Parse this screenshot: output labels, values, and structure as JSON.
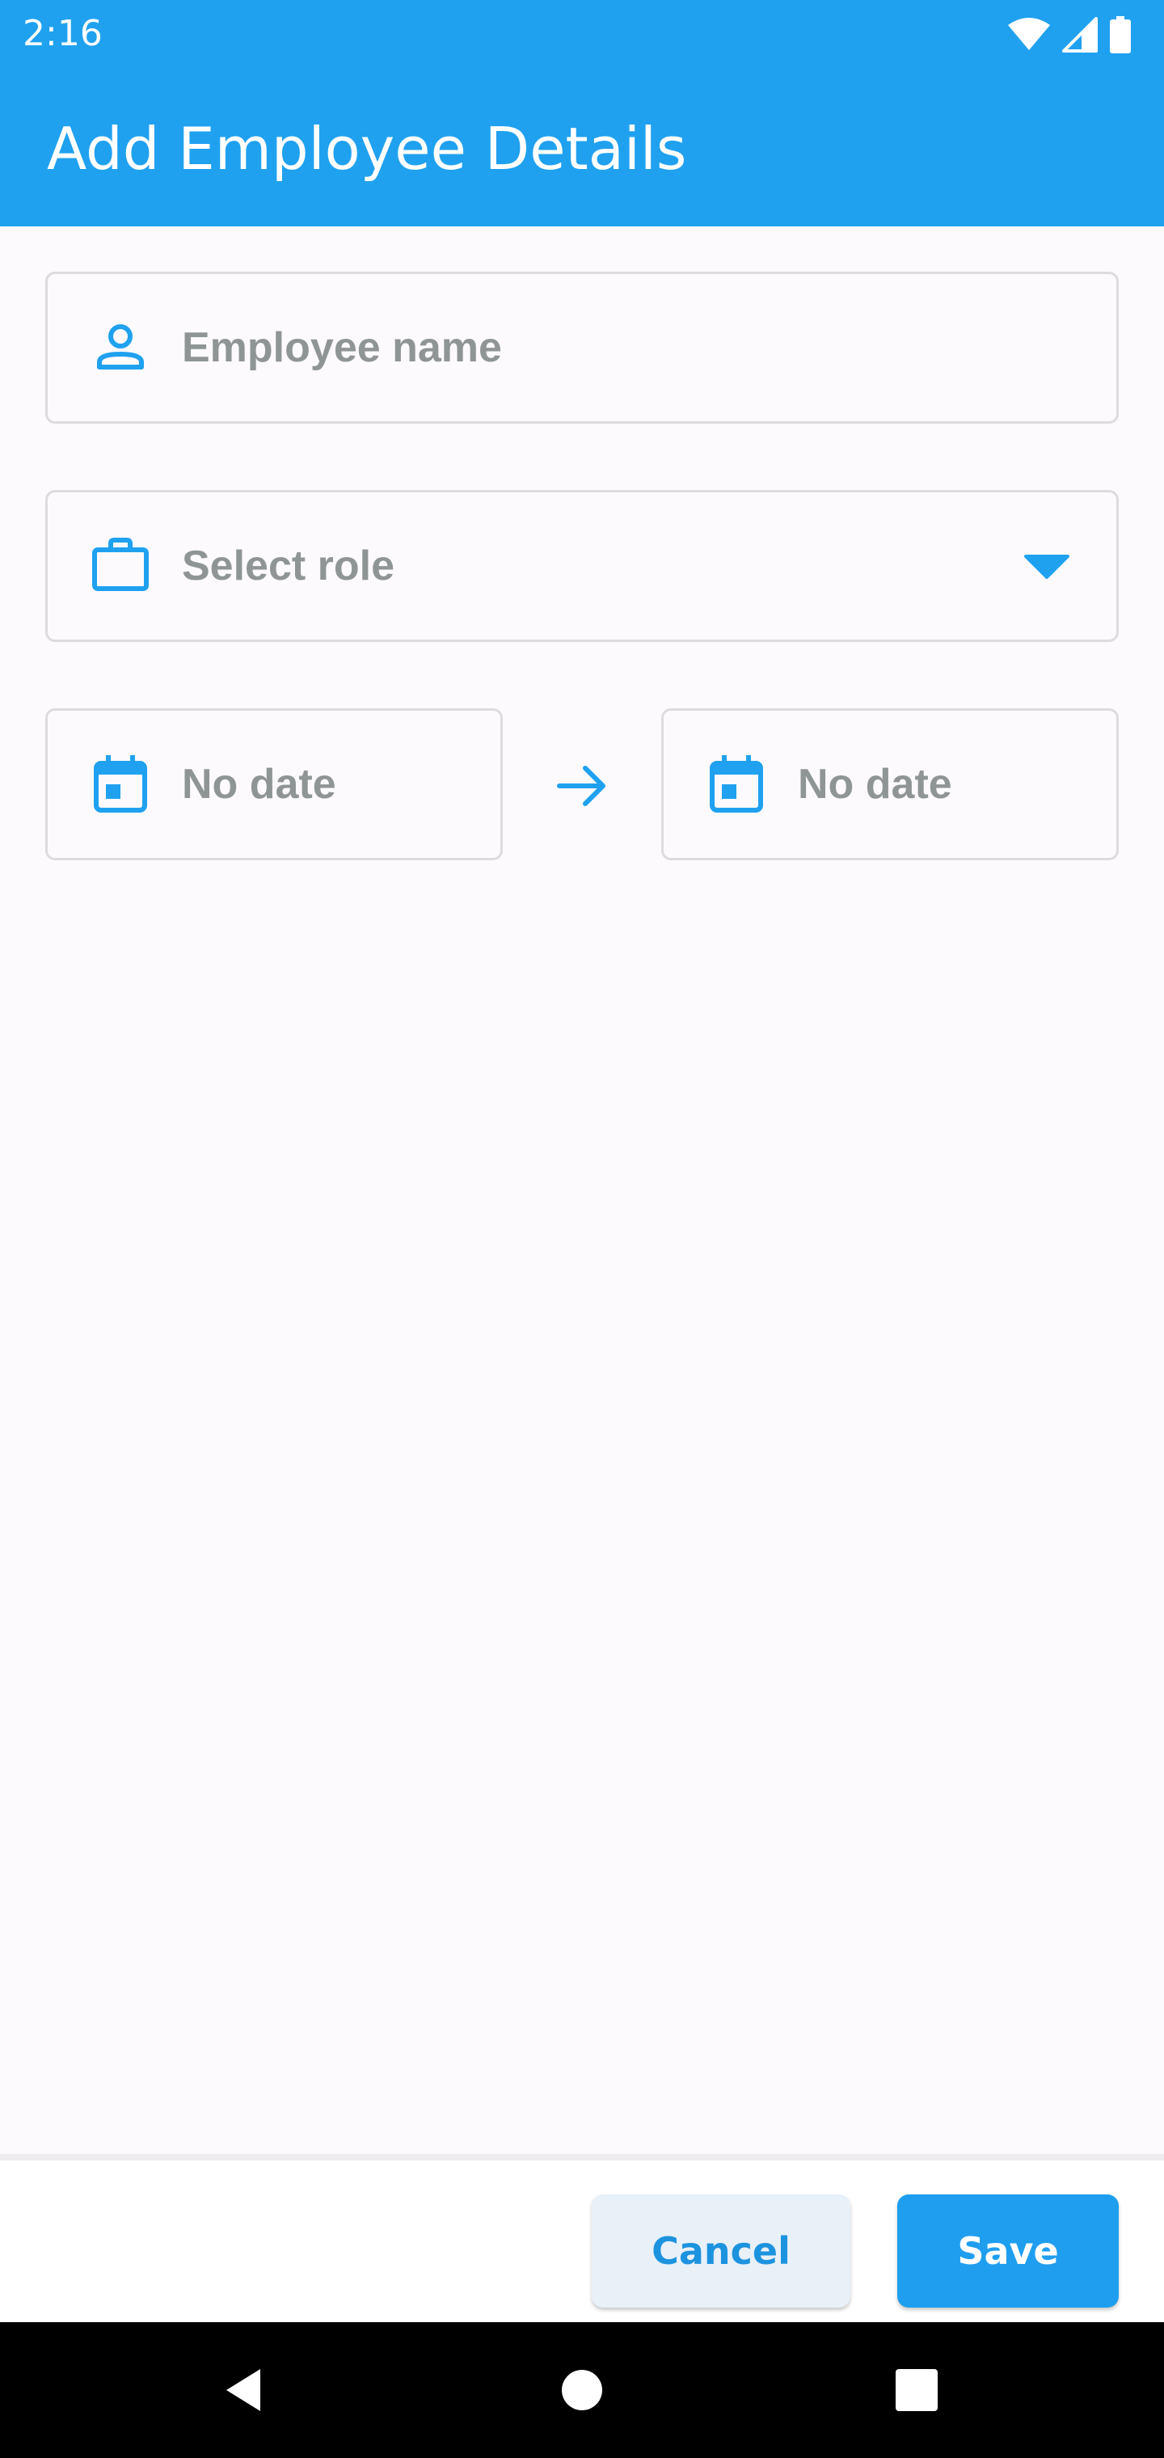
{
  "status_bar": {
    "time": "2:16",
    "icons": [
      "wifi-icon",
      "cellular-signal-icon",
      "battery-icon"
    ]
  },
  "app_bar": {
    "title": "Add Employee Details"
  },
  "form": {
    "employee_name": {
      "placeholder": "Employee name",
      "icon": "person-icon"
    },
    "role": {
      "placeholder": "Select role",
      "icon": "briefcase-icon",
      "dropdown_icon": "dropdown-arrow-icon"
    },
    "start_date": {
      "value": "No date",
      "icon": "calendar-icon"
    },
    "range_arrow_icon": "arrow-right-icon",
    "end_date": {
      "value": "No date",
      "icon": "calendar-icon"
    }
  },
  "actions": {
    "cancel_label": "Cancel",
    "save_label": "Save"
  },
  "nav_bar": {
    "icons": [
      "back-icon",
      "home-icon",
      "recents-icon"
    ]
  },
  "colors": {
    "primary": "#1fa1f0",
    "background": "#fdfafd",
    "placeholder_text": "#8f9595",
    "field_border": "#dcdcdc",
    "cancel_background": "#e8f0f8"
  }
}
